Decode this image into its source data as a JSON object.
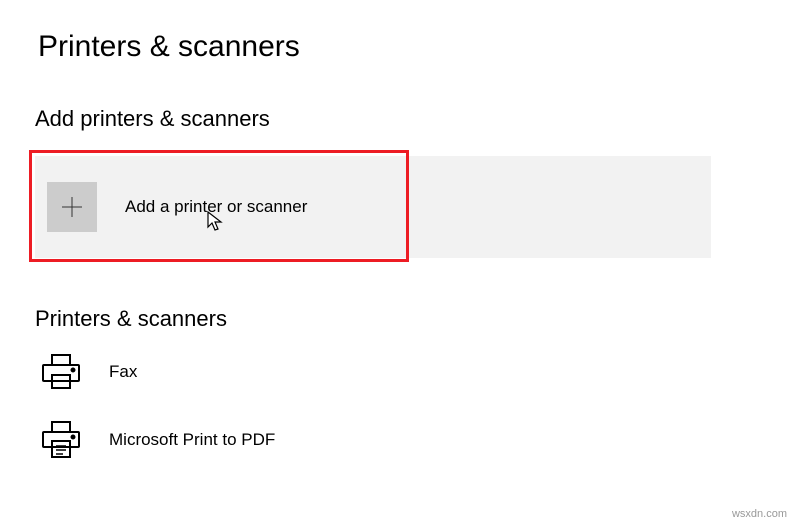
{
  "page": {
    "title": "Printers & scanners"
  },
  "add_section": {
    "title": "Add printers & scanners",
    "button_label": "Add a printer or scanner"
  },
  "printers_section": {
    "title": "Printers & scanners",
    "devices": [
      {
        "name": "Fax"
      },
      {
        "name": "Microsoft Print to PDF"
      }
    ]
  },
  "watermark": "wsxdn.com"
}
